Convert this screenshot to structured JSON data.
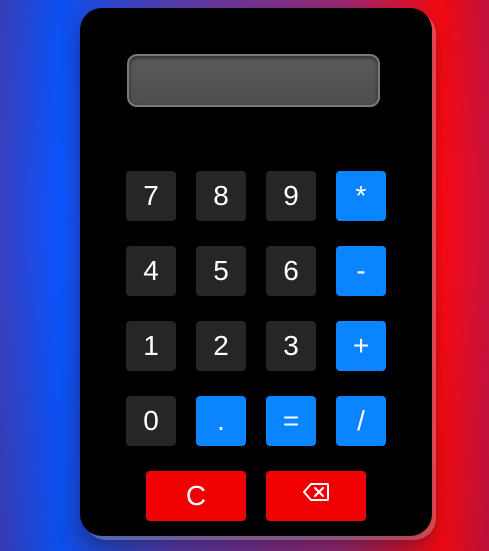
{
  "display": {
    "value": ""
  },
  "keypad": {
    "row1": [
      "7",
      "8",
      "9",
      "*"
    ],
    "row2": [
      "4",
      "5",
      "6",
      "-"
    ],
    "row3": [
      "1",
      "2",
      "3",
      "+"
    ],
    "row4": [
      "0",
      ".",
      "=",
      "/"
    ],
    "clear_label": "C",
    "backspace_icon": "backspace-icon"
  },
  "colors": {
    "calculator_body": "#000000",
    "display_bg": "#555555",
    "number_key": "#262626",
    "operator_key": "#0a84ff",
    "action_key": "#f00000",
    "key_text": "#ffffff"
  }
}
